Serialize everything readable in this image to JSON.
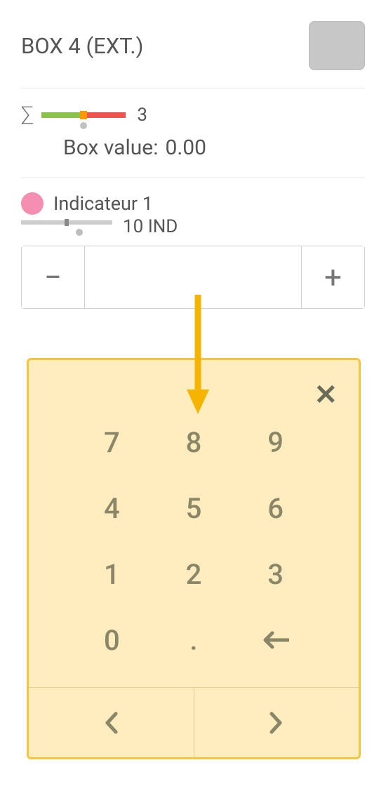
{
  "header": {
    "title": "BOX 4 (EXT.)",
    "swatch_color": "#c7c7c7"
  },
  "sigma": {
    "count": "3"
  },
  "box_value": {
    "label": "Box value:",
    "value": "0.00"
  },
  "indicator": {
    "color": "#f48fb1",
    "label": "Indicateur 1",
    "count": "10",
    "unit": "IND"
  },
  "stepper": {
    "minus": "−",
    "plus": "+",
    "value": ""
  },
  "keypad": {
    "close": "✕",
    "keys": [
      "7",
      "8",
      "9",
      "4",
      "5",
      "6",
      "1",
      "2",
      "3",
      "0",
      ".",
      "←"
    ],
    "prev": "〈",
    "next": "〉"
  },
  "arrow_color": "#f5b400"
}
